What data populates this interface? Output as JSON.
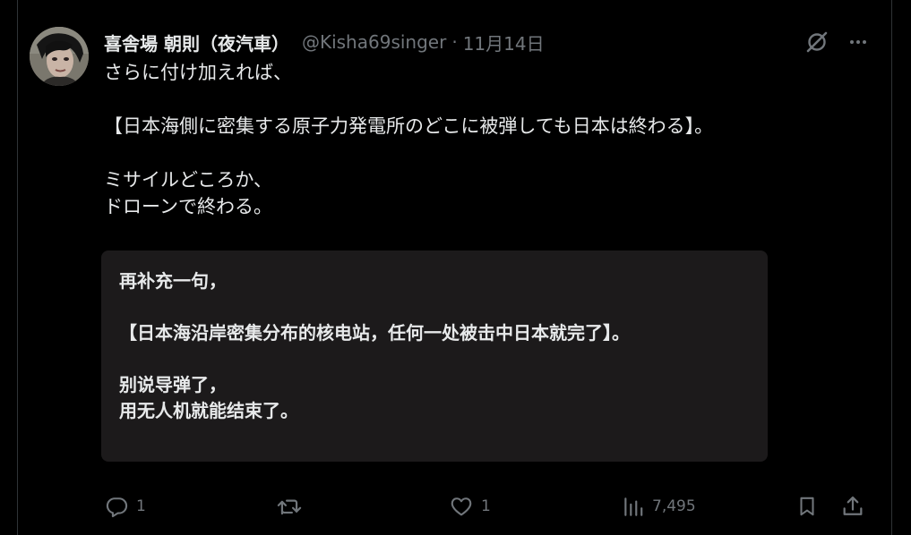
{
  "post": {
    "author_name": "喜舎場 朝則（夜汽車）",
    "handle": "@Kisha69singer",
    "separator": "·",
    "date": "11月14日",
    "text_lines": [
      "さらに付け加えれば、",
      "",
      "【日本海側に密集する原子力発電所のどこに被弾しても日本は終わる】。",
      "",
      "ミサイルどころか、",
      "ドローンで終わる。"
    ]
  },
  "translation_box": {
    "lines": [
      "再补充一句，",
      "",
      "【日本海沿岸密集分布的核电站，任何一处被击中日本就完了】。",
      "",
      "别说导弹了，",
      "用无人机就能结束了。"
    ]
  },
  "actions": {
    "reply_count": "1",
    "retweet_count": "",
    "like_count": "1",
    "views_count": "7,495"
  },
  "icons": {
    "grok": "grok-icon",
    "more": "more-icon",
    "reply": "reply-icon",
    "retweet": "retweet-icon",
    "like": "like-icon",
    "views": "views-icon",
    "bookmark": "bookmark-icon",
    "share": "share-icon"
  },
  "colors": {
    "background": "#000000",
    "text_primary": "#e7e9ea",
    "text_secondary": "#71767b",
    "translation_bg": "#1c1a1b",
    "divider": "#2f3336"
  }
}
